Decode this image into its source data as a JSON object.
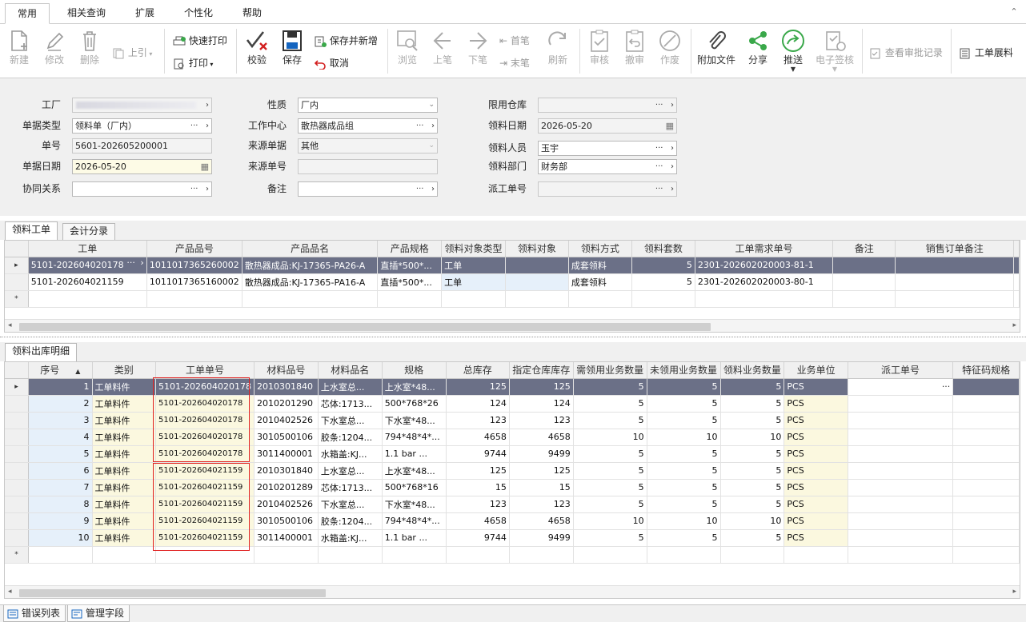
{
  "menu": {
    "tabs": [
      "常用",
      "相关查询",
      "扩展",
      "个性化",
      "帮助"
    ],
    "collapse": "⌃"
  },
  "toolbar": {
    "new": "新建",
    "edit": "修改",
    "delete": "删除",
    "upref": "上引",
    "quickprint": "快速打印",
    "print": "打印",
    "check": "校验",
    "save": "保存",
    "save_new": "保存并新增",
    "cancel": "取消",
    "browse": "浏览",
    "prev": "上笔",
    "next": "下笔",
    "first": "首笔",
    "last": "末笔",
    "refresh": "刷新",
    "audit": "审核",
    "unaudit": "撤审",
    "void": "作废",
    "attach": "附加文件",
    "share": "分享",
    "push": "推送",
    "esign": "电子签核",
    "audit_log": "查看审批记录",
    "expand": "工单展料"
  },
  "form": {
    "factory_label": "工厂",
    "factory_value": "",
    "doctype_label": "单据类型",
    "doctype_value": "领料单（厂内）",
    "docno_label": "单号",
    "docno_value": "5601-202605200001",
    "docdate_label": "单据日期",
    "docdate_value": "2026-05-20",
    "collab_label": "协同关系",
    "collab_value": "",
    "nature_label": "性质",
    "nature_value": "厂内",
    "workcenter_label": "工作中心",
    "workcenter_value": "散热器成品组",
    "srcdoc_label": "来源单据",
    "srcdoc_value": "其他",
    "srcno_label": "来源单号",
    "srcno_value": "",
    "remark_label": "备注",
    "remark_value": "",
    "wh_label": "限用仓库",
    "wh_value": "",
    "pickdate_label": "领料日期",
    "pickdate_value": "2026-05-20",
    "picker_label": "领料人员",
    "picker_value": "玉宇",
    "dept_label": "领料部门",
    "dept_value": "财务部",
    "dispatch_label": "派工单号",
    "dispatch_value": "",
    "dots": "···",
    "arrow": "›"
  },
  "upper_tabs": [
    "领料工单",
    "会计分录"
  ],
  "upper_grid": {
    "columns": [
      "工单",
      "产品品号",
      "产品品名",
      "产品规格",
      "领料对象类型",
      "领料对象",
      "领料方式",
      "领料套数",
      "工单需求单号",
      "备注",
      "销售订单备注"
    ],
    "rows": [
      {
        "marker": "▸",
        "wo": "5101-202604020178",
        "code": "1011017365260002",
        "name": "散热器成品:KJ-17365-PA26-A",
        "spec": "直插*500*...",
        "objtype": "工单",
        "obj": "",
        "method": "成套领料",
        "sets": "5",
        "req": "2301-202602020003-81-1",
        "remark": "",
        "so": ""
      },
      {
        "marker": "",
        "wo": "5101-202604021159",
        "code": "1011017365160002",
        "name": "散热器成品:KJ-17365-PA16-A",
        "spec": "直插*500*...",
        "objtype": "工单",
        "obj": "",
        "method": "成套领料",
        "sets": "5",
        "req": "2301-202602020003-80-1",
        "remark": "",
        "so": ""
      }
    ],
    "new_marker": "*",
    "wo_btn": "···"
  },
  "lower_tabs": [
    "领料出库明细"
  ],
  "lower_grid": {
    "columns": [
      "序号",
      "类别",
      "工单单号",
      "材料品号",
      "材料品名",
      "规格",
      "总库存",
      "指定仓库库存",
      "需领用业务数量",
      "未领用业务数量",
      "领料业务数量",
      "业务单位",
      "派工单号",
      "特征码规格"
    ],
    "sort_indicator": "▲",
    "rows": [
      {
        "marker": "▸",
        "seq": "1",
        "cat": "工单料件",
        "wo": "5101-202604020178",
        "code": "2010301840",
        "name": "上水室总...",
        "spec": "上水室*48...",
        "total": "125",
        "wh": "125",
        "need": "5",
        "unpicked": "5",
        "qty": "5",
        "unit": "PCS",
        "dispatch": "···",
        "feature": ""
      },
      {
        "marker": "",
        "seq": "2",
        "cat": "工单料件",
        "wo": "5101-202604020178",
        "code": "2010201290",
        "name": "芯体:1713...",
        "spec": "500*768*26",
        "total": "124",
        "wh": "124",
        "need": "5",
        "unpicked": "5",
        "qty": "5",
        "unit": "PCS",
        "dispatch": "",
        "feature": ""
      },
      {
        "marker": "",
        "seq": "3",
        "cat": "工单料件",
        "wo": "5101-202604020178",
        "code": "2010402526",
        "name": "下水室总...",
        "spec": "下水室*48...",
        "total": "123",
        "wh": "123",
        "need": "5",
        "unpicked": "5",
        "qty": "5",
        "unit": "PCS",
        "dispatch": "",
        "feature": ""
      },
      {
        "marker": "",
        "seq": "4",
        "cat": "工单料件",
        "wo": "5101-202604020178",
        "code": "3010500106",
        "name": "胶条:1204...",
        "spec": "794*48*4*...",
        "total": "4658",
        "wh": "4658",
        "need": "10",
        "unpicked": "10",
        "qty": "10",
        "unit": "PCS",
        "dispatch": "",
        "feature": ""
      },
      {
        "marker": "",
        "seq": "5",
        "cat": "工单料件",
        "wo": "5101-202604020178",
        "code": "3011400001",
        "name": "水箱盖:KJ...",
        "spec": "1.1 bar  ...",
        "total": "9744",
        "wh": "9499",
        "need": "5",
        "unpicked": "5",
        "qty": "5",
        "unit": "PCS",
        "dispatch": "",
        "feature": ""
      },
      {
        "marker": "",
        "seq": "6",
        "cat": "工单料件",
        "wo": "5101-202604021159",
        "code": "2010301840",
        "name": "上水室总...",
        "spec": "上水室*48...",
        "total": "125",
        "wh": "125",
        "need": "5",
        "unpicked": "5",
        "qty": "5",
        "unit": "PCS",
        "dispatch": "",
        "feature": ""
      },
      {
        "marker": "",
        "seq": "7",
        "cat": "工单料件",
        "wo": "5101-202604021159",
        "code": "2010201289",
        "name": "芯体:1713...",
        "spec": "500*768*16",
        "total": "15",
        "wh": "15",
        "need": "5",
        "unpicked": "5",
        "qty": "5",
        "unit": "PCS",
        "dispatch": "",
        "feature": ""
      },
      {
        "marker": "",
        "seq": "8",
        "cat": "工单料件",
        "wo": "5101-202604021159",
        "code": "2010402526",
        "name": "下水室总...",
        "spec": "下水室*48...",
        "total": "123",
        "wh": "123",
        "need": "5",
        "unpicked": "5",
        "qty": "5",
        "unit": "PCS",
        "dispatch": "",
        "feature": ""
      },
      {
        "marker": "",
        "seq": "9",
        "cat": "工单料件",
        "wo": "5101-202604021159",
        "code": "3010500106",
        "name": "胶条:1204...",
        "spec": "794*48*4*...",
        "total": "4658",
        "wh": "4658",
        "need": "10",
        "unpicked": "10",
        "qty": "10",
        "unit": "PCS",
        "dispatch": "",
        "feature": ""
      },
      {
        "marker": "",
        "seq": "10",
        "cat": "工单料件",
        "wo": "5101-202604021159",
        "code": "3011400001",
        "name": "水箱盖:KJ...",
        "spec": "1.1 bar  ...",
        "total": "9744",
        "wh": "9499",
        "need": "5",
        "unpicked": "5",
        "qty": "5",
        "unit": "PCS",
        "dispatch": "",
        "feature": ""
      }
    ],
    "new_marker": "*"
  },
  "statusbar": {
    "errors": "错误列表",
    "fields": "管理字段"
  },
  "colors": {
    "selected_row": "#6b7087",
    "light_blue": "#e6f0fa",
    "light_yellow": "#fbf8df",
    "annotation_red": "#e02020",
    "icon_blue": "#1565c0",
    "icon_green": "#3aa84a",
    "icon_gray": "#8a8a8a"
  }
}
